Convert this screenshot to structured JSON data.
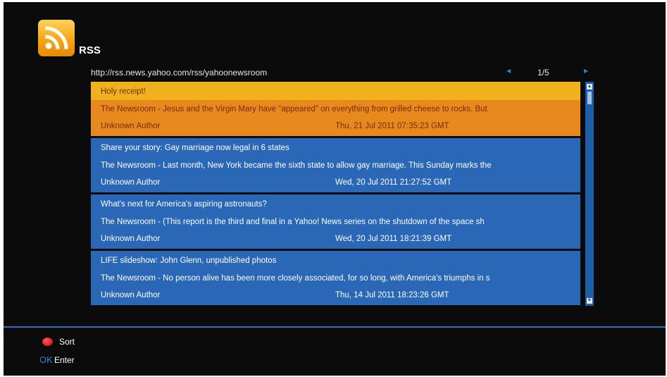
{
  "app": {
    "title": "RSS"
  },
  "feed": {
    "url": "http://rss.news.yahoo.com/rss/yahoonewsroom",
    "page": "1/5"
  },
  "items": [
    {
      "title": "Holy receipt!",
      "summary": "The Newsroom - Jesus and the Virgin Mary have \"appeared\" on everything from grilled cheese to rocks. But",
      "author": "Unknown Author",
      "date": "Thu, 21 Jul 2011 07:35:23 GMT"
    },
    {
      "title": "Share your story: Gay marriage now legal in 6 states",
      "summary": "The Newsroom - Last month, New York became the sixth state to allow gay marriage. This Sunday marks the",
      "author": "Unknown Author",
      "date": "Wed, 20 Jul 2011 21:27:52 GMT"
    },
    {
      "title": "What's next for America's aspiring astronauts?",
      "summary": "The Newsroom - (This report is the third and final in a Yahoo! News series on the shutdown of the space sh",
      "author": "Unknown Author",
      "date": "Wed, 20 Jul 2011 18:21:39 GMT"
    },
    {
      "title": "LIFE slideshow: John Glenn, unpublished photos",
      "summary": "The Newsroom - No person alive has been more closely associated, for so long, with America's triumphs in s",
      "author": "Unknown Author",
      "date": "Thu, 14 Jul 2011 18:23:26 GMT"
    }
  ],
  "footer": {
    "sort_label": "Sort",
    "ok_key": "OK",
    "enter_label": "Enter"
  },
  "colors": {
    "accent": "#2b6fc0",
    "selected": "#e8891d",
    "item": "#2a67b6"
  },
  "icons": {
    "logo": "rss-feed-icon",
    "prev": "left-arrow-icon",
    "next": "right-arrow-icon",
    "sort_key": "red-button-icon"
  }
}
